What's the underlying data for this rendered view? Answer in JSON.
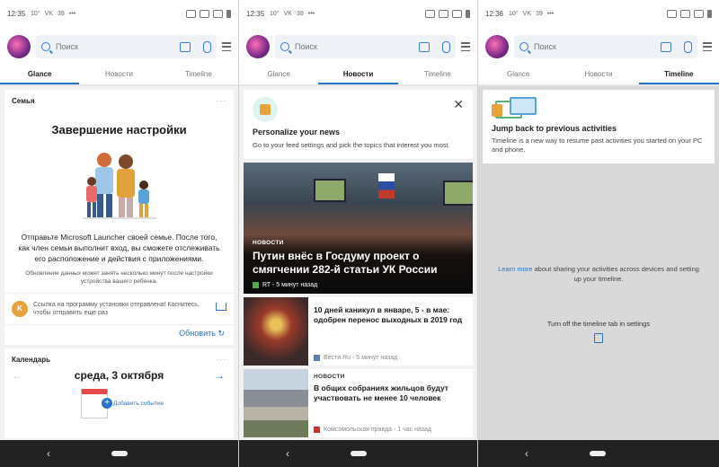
{
  "phones": [
    {
      "status": {
        "time": "12:35",
        "extra1": "10°",
        "extra2": "VK",
        "extra3": "39",
        "extra4": "•••"
      },
      "search": {
        "placeholder": "Поиск"
      },
      "tabs": [
        "Glance",
        "Новости",
        "Timeline"
      ]
    },
    {
      "status": {
        "time": "12:35",
        "extra1": "10°",
        "extra2": "VK",
        "extra3": "39",
        "extra4": "•••"
      },
      "search": {
        "placeholder": "Поиск"
      },
      "tabs": [
        "Glance",
        "Новости",
        "Timeline"
      ]
    },
    {
      "status": {
        "time": "12:36",
        "extra1": "10°",
        "extra2": "VK",
        "extra3": "39",
        "extra4": "•••"
      },
      "search": {
        "placeholder": "Поиск"
      },
      "tabs": [
        "Glance",
        "Новости",
        "Timeline"
      ]
    }
  ],
  "glance": {
    "family": {
      "header": "Семья",
      "title": "Завершение настройки",
      "body": "Отправьте Microsoft Launcher своей семье. После того, как член семьи выполнит вход, вы сможете отслеживать его расположение и действия с приложениями.",
      "small": "Обновление данных может занять несколько минут после настройки устройства вашего ребенка.",
      "notice_badge": "K",
      "notice": "Ссылка на программу установки отправлена! Коснитесь, чтобы отправить еще раз",
      "refresh": "Обновить"
    },
    "calendar": {
      "header": "Календарь",
      "date": "среда, 3 октября",
      "add": "Добавить событие"
    }
  },
  "news": {
    "personalize": {
      "title": "Personalize your news",
      "text": "Go to your feed settings and pick the topics that interest you most."
    },
    "hero": {
      "category": "НОВОСТИ",
      "title": "Путин внёс в Госдуму проект о смягчении 282-й статьи УК России",
      "source": "RT - 5 минут назад"
    },
    "items": [
      {
        "title": "10 дней каникул в январе, 5 - в мае: одобрен перенос выходных в 2019 год",
        "source": "Вести.Ru - 5 минут назад"
      },
      {
        "category": "НОВОСТИ",
        "title": "В общих собраниях жильцов будут участвовать не менее 10 человек",
        "source": "Комсомольская правда - 1 час назад"
      }
    ]
  },
  "timeline": {
    "title": "Jump back to previous activities",
    "text": "Timeline is a new way to resume past activities you started on your PC and phone.",
    "learn_link": "Learn more",
    "learn_rest": " about sharing your activities across devices and setting up your timeline.",
    "off": "Turn off the timeline tab in settings"
  },
  "nav": {
    "back": "‹"
  }
}
